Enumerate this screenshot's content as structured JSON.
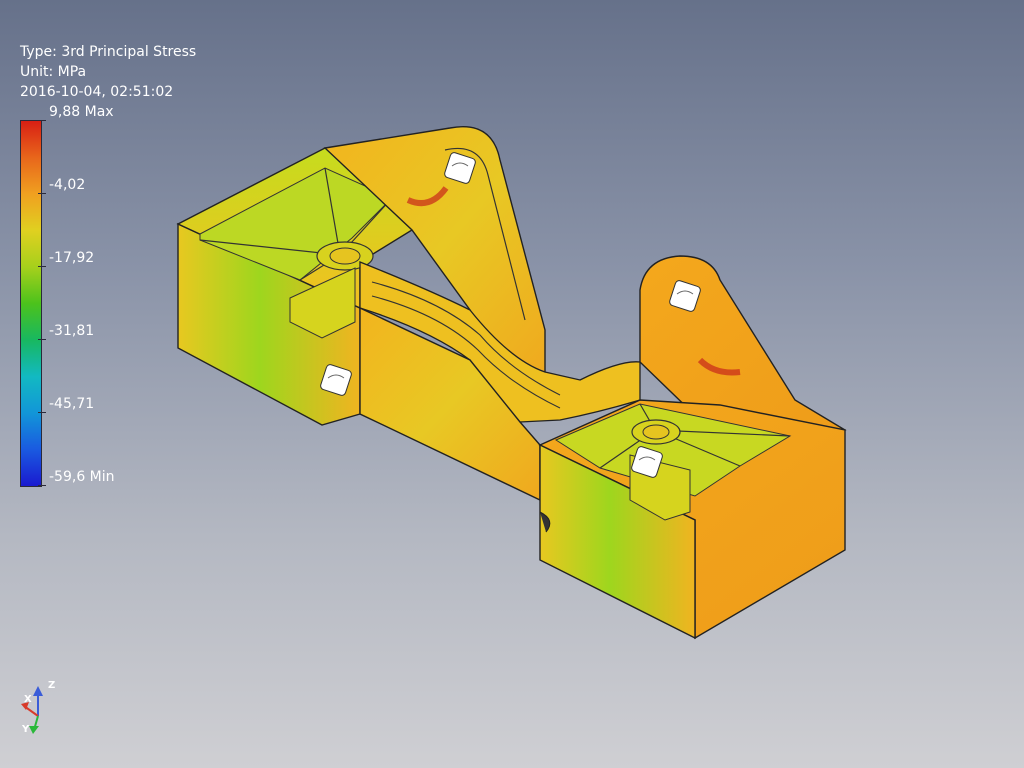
{
  "info": {
    "type_line": "Type: 3rd Principal Stress",
    "unit_line": "Unit: MPa",
    "timestamp_line": "2016-10-04, 02:51:02"
  },
  "legend": {
    "labels": [
      "9,88 Max",
      "-4,02",
      "-17,92",
      "-31,81",
      "-45,71",
      "-59,6 Min"
    ]
  },
  "triad": {
    "x_label": "X",
    "y_label": "Y",
    "z_label": "Z"
  }
}
